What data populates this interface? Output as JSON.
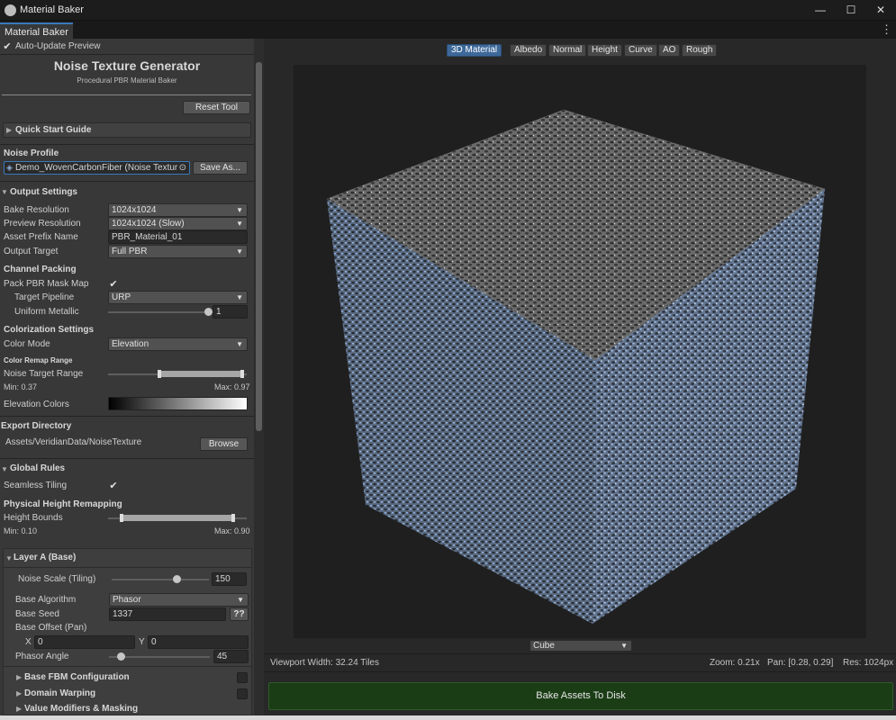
{
  "window": {
    "title": "Material Baker",
    "controls": [
      "—",
      "☐",
      "✕"
    ]
  },
  "tab": {
    "label": "Material Baker",
    "menu": "⋮"
  },
  "auto_update": {
    "label": "Auto-Update Preview",
    "checked": true
  },
  "header": {
    "title": "Noise Texture Generator",
    "subtitle": "Procedural PBR Material Baker"
  },
  "reset_tool": "Reset Tool",
  "quick_start": "Quick Start Guide",
  "noise_profile": {
    "title": "Noise Profile",
    "value": "Demo_WovenCarbonFiber (Noise Texture",
    "save_as": "Save As..."
  },
  "output_settings": {
    "title": "Output Settings",
    "bake_resolution": {
      "label": "Bake Resolution",
      "value": "1024x1024"
    },
    "preview_resolution": {
      "label": "Preview Resolution",
      "value": "1024x1024 (Slow)"
    },
    "asset_prefix": {
      "label": "Asset Prefix Name",
      "value": "PBR_Material_01"
    },
    "output_target": {
      "label": "Output Target",
      "value": "Full PBR"
    }
  },
  "channel_packing": {
    "title": "Channel Packing",
    "pack_mask": {
      "label": "Pack PBR Mask Map",
      "checked": true
    },
    "target_pipeline": {
      "label": "Target Pipeline",
      "value": "URP"
    },
    "uniform_metallic": {
      "label": "Uniform Metallic",
      "value": "1",
      "fraction": 1.0
    }
  },
  "colorization": {
    "title": "Colorization Settings",
    "color_mode": {
      "label": "Color Mode",
      "value": "Elevation"
    },
    "remap_title": "Color Remap Range",
    "target_range": {
      "label": "Noise Target Range",
      "min": "Min: 0.37",
      "max": "Max: 0.97",
      "min_value": 0.37,
      "max_value": 0.97
    },
    "elevation_colors": {
      "label": "Elevation Colors"
    }
  },
  "export": {
    "title": "Export Directory",
    "path": "Assets/VeridianData/NoiseTexture",
    "browse": "Browse"
  },
  "global_rules": {
    "title": "Global Rules",
    "seamless": {
      "label": "Seamless Tiling",
      "checked": true
    },
    "height_title": "Physical Height Remapping",
    "height_bounds": {
      "label": "Height Bounds",
      "min": "Min: 0.10",
      "max": "Max: 0.90",
      "min_value": 0.1,
      "max_value": 0.9
    }
  },
  "layer_a": {
    "title": "Layer A (Base)",
    "noise_scale": {
      "label": "Noise Scale (Tiling)",
      "value": "150",
      "fraction": 0.68
    },
    "base_algorithm": {
      "label": "Base Algorithm",
      "value": "Phasor"
    },
    "base_seed": {
      "label": "Base Seed",
      "value": "1337",
      "random": "??"
    },
    "base_offset": {
      "label": "Base Offset (Pan)",
      "x_label": "X",
      "x": "0",
      "y_label": "Y",
      "y": "0"
    },
    "phasor_angle": {
      "label": "Phasor Angle",
      "value": "45",
      "fraction": 0.125
    },
    "fbm": "Base FBM Configuration",
    "warping": "Domain Warping",
    "modifiers": "Value Modifiers & Masking"
  },
  "view_tabs": [
    {
      "label": "3D Material",
      "active": true
    },
    {
      "label": "Albedo",
      "active": false
    },
    {
      "label": "Normal",
      "active": false
    },
    {
      "label": "Height",
      "active": false
    },
    {
      "label": "Curve",
      "active": false
    },
    {
      "label": "AO",
      "active": false
    },
    {
      "label": "Rough",
      "active": false
    }
  ],
  "mesh_select": {
    "value": "Cube"
  },
  "status": {
    "viewport_width": "Viewport Width: 32.24 Tiles",
    "zoom": "Zoom: 0.21x",
    "pan": "Pan: [0.28, 0.29]",
    "res": "Res: 1024px"
  },
  "bake_button": "Bake Assets To Disk",
  "colors": {
    "accent": "#3d6899",
    "bake": "#1b3d16",
    "cube_blue": "#6f8fb8"
  },
  "icons": {
    "check": "✔",
    "fold_closed": "▶",
    "fold_open": "▼",
    "dropdown": "▼",
    "object_picker": "⊙"
  }
}
